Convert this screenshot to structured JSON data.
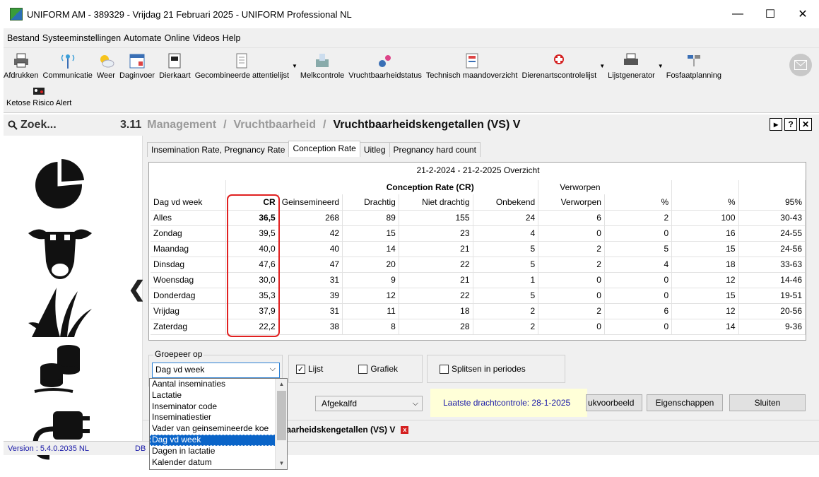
{
  "window": {
    "title": "UNIFORM AM - 389329 - Vrijdag 21 Februari 2025 - UNIFORM Professional NL",
    "min": "—",
    "max": "☐",
    "close": "✕"
  },
  "menu": [
    "Bestand",
    "Systeeminstellingen",
    "Automate",
    "Online",
    "Videos",
    "Help"
  ],
  "toolbar": {
    "items": [
      "Afdrukken",
      "Communicatie",
      "Weer",
      "Daginvoer",
      "Dierkaart",
      "Gecombineerde attentielijst",
      "Melkcontrole",
      "Vruchtbaarheidstatus",
      "Technisch maandoverzicht",
      "Dierenartscontrolelijst",
      "Lijstgenerator",
      "Fosfaatplanning"
    ],
    "row2": [
      "Ketose Risico Alert"
    ]
  },
  "search": {
    "label": "Zoek..."
  },
  "breadcrumb": {
    "number": "3.11",
    "path": [
      "Management",
      "Vruchtbaarheid"
    ],
    "current": "Vruchtbaarheidskengetallen (VS) V",
    "sep": "/"
  },
  "tabs": [
    "Insemination Rate, Pregnancy Rate",
    "Conception Rate",
    "Uitleg",
    "Pregnancy hard count"
  ],
  "grid": {
    "period": "21-2-2024 - 21-2-2025 Overzicht",
    "group_conception": "Conception Rate (CR)",
    "group_verworpen": "Verworpen",
    "headers": [
      "Dag vd week",
      "CR",
      "Geinsemineerd",
      "Drachtig",
      "Niet drachtig",
      "Onbekend",
      "Verworpen",
      "%",
      "%",
      "95%"
    ],
    "rows": [
      [
        "Alles",
        "36,5",
        "268",
        "89",
        "155",
        "24",
        "6",
        "2",
        "100",
        "30-43"
      ],
      [
        "Zondag",
        "39,5",
        "42",
        "15",
        "23",
        "4",
        "0",
        "0",
        "16",
        "24-55"
      ],
      [
        "Maandag",
        "40,0",
        "40",
        "14",
        "21",
        "5",
        "2",
        "5",
        "15",
        "24-56"
      ],
      [
        "Dinsdag",
        "47,6",
        "47",
        "20",
        "22",
        "5",
        "2",
        "4",
        "18",
        "33-63"
      ],
      [
        "Woensdag",
        "30,0",
        "31",
        "9",
        "21",
        "1",
        "0",
        "0",
        "12",
        "14-46"
      ],
      [
        "Donderdag",
        "35,3",
        "39",
        "12",
        "22",
        "5",
        "0",
        "0",
        "15",
        "19-51"
      ],
      [
        "Vrijdag",
        "37,9",
        "31",
        "11",
        "18",
        "2",
        "2",
        "6",
        "12",
        "20-56"
      ],
      [
        "Zaterdag",
        "22,2",
        "38",
        "8",
        "28",
        "2",
        "0",
        "0",
        "14",
        "9-36"
      ]
    ]
  },
  "controls": {
    "groepeer_label": "Groepeer op",
    "groepeer_value": "Dag vd week",
    "lijst": "Lijst",
    "grafiek": "Grafiek",
    "splitsen": "Splitsen in periodes",
    "afgekalfd": "Afgekalfd",
    "laatste": "Laatste drachtcontrole: 28-1-2025",
    "afdrukvoorbeeld": "ukvoorbeeld",
    "eigenschappen": "Eigenschappen",
    "sluiten": "Sluiten"
  },
  "dropdown": {
    "options": [
      "Aantal inseminaties",
      "Lactatie",
      "Inseminator code",
      "Inseminatiestier",
      "Vader van geinsemineerde koe",
      "Dag vd week",
      "Dagen in lactatie",
      "Kalender datum"
    ],
    "selected_index": 5
  },
  "bottom_tab": {
    "label": "tbaarheidskengetallen (VS) V",
    "close": "x"
  },
  "status": {
    "version": "Version : 5.4.0.2035 NL",
    "db": "DB"
  },
  "colors": {
    "highlight": "#e02020",
    "selection": "#0a64c8",
    "link": "#1a1aa8"
  }
}
